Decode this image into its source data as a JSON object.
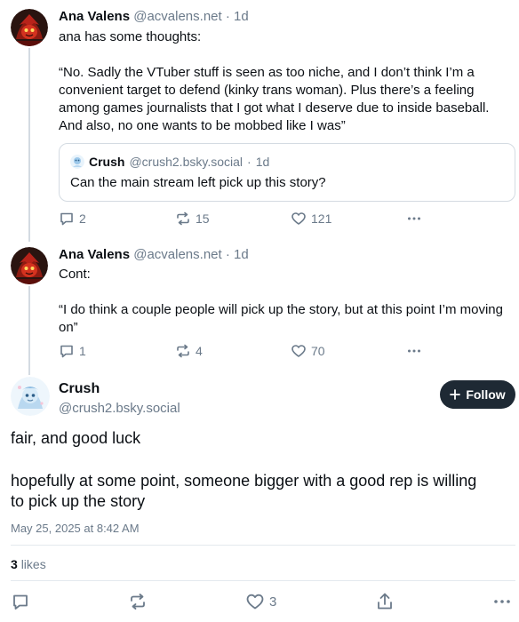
{
  "colors": {
    "text": "#0b0f14",
    "muted": "#6b7a8a",
    "border": "#d4dbe2",
    "follow_bg": "#1e2934",
    "follow_fg": "#ffffff"
  },
  "thread": [
    {
      "author": {
        "display_name": "Ana Valens",
        "handle": "@acvalens.net",
        "separator": "·",
        "time": "1d",
        "avatar_icon": "red-character-avatar"
      },
      "intro": "ana has some thoughts:",
      "quote_text": "“No. Sadly the VTuber stuff is seen as too niche, and I don’t think I’m a convenient target to defend (kinky trans woman). Plus there’s a feeling among games journalists that I got what I deserve due to inside baseball. And also, no one wants to be mobbed like I was”",
      "embed": {
        "display_name": "Crush",
        "handle": "@crush2.bsky.social",
        "separator": "·",
        "time": "1d",
        "text": "Can the main stream left  pick up this story?"
      },
      "counts": {
        "replies": "2",
        "reposts": "15",
        "likes": "121"
      }
    },
    {
      "author": {
        "display_name": "Ana Valens",
        "handle": "@acvalens.net",
        "separator": "·",
        "time": "1d",
        "avatar_icon": "red-character-avatar"
      },
      "intro": "Cont:",
      "quote_text": "“I do think a couple people will pick up the story, but at this point I’m moving on”",
      "counts": {
        "replies": "1",
        "reposts": "4",
        "likes": "70"
      }
    }
  ],
  "main_post": {
    "display_name": "Crush",
    "handle": "@crush2.bsky.social",
    "follow_label": "Follow",
    "follow_icon": "plus-icon",
    "paragraph1": "fair, and good luck",
    "paragraph2": "hopefully at some point, someone bigger with a good rep is willing to pick up the story",
    "date": "May 25, 2025 at 8:42 AM",
    "likes_count": "3",
    "likes_label": "likes",
    "like_count_bar": "3"
  }
}
